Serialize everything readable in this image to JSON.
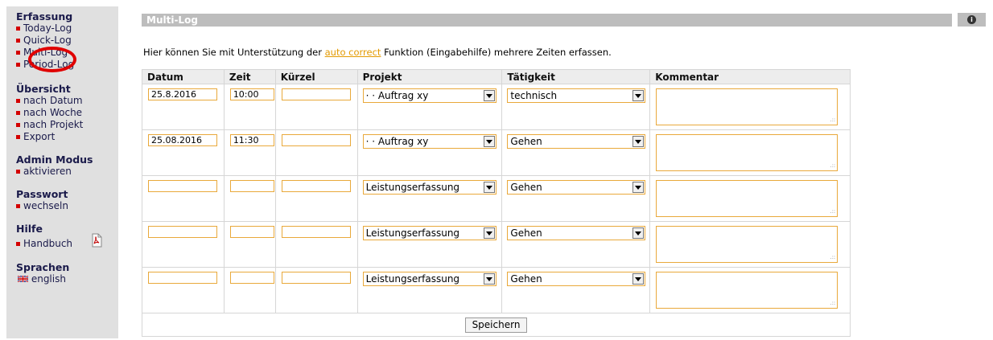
{
  "sidebar": {
    "sections": [
      {
        "title": "Erfassung",
        "items": [
          {
            "label": "Today-Log"
          },
          {
            "label": "Quick-Log"
          },
          {
            "label": "Multi-Log"
          },
          {
            "label": "Period-Log"
          }
        ]
      },
      {
        "title": "Übersicht",
        "items": [
          {
            "label": "nach Datum"
          },
          {
            "label": "nach Woche"
          },
          {
            "label": "nach Projekt"
          },
          {
            "label": "Export"
          }
        ]
      },
      {
        "title": "Admin Modus",
        "items": [
          {
            "label": "aktivieren"
          }
        ]
      },
      {
        "title": "Passwort",
        "items": [
          {
            "label": "wechseln"
          }
        ]
      },
      {
        "title": "Hilfe",
        "items": [
          {
            "label": "Handbuch"
          }
        ]
      },
      {
        "title": "Sprachen",
        "items": [
          {
            "label": "english"
          }
        ]
      }
    ]
  },
  "header": {
    "title": "Multi-Log",
    "info_icon": "info-icon"
  },
  "intro": {
    "before": "Hier können Sie mit Unterstützung der ",
    "link": "auto correct",
    "after": " Funktion (Eingabehilfe) mehrere Zeiten erfassen."
  },
  "table": {
    "columns": [
      "Datum",
      "Zeit",
      "Kürzel",
      "Projekt",
      "Tätigkeit",
      "Kommentar"
    ],
    "rows": [
      {
        "datum": "25.8.2016",
        "zeit": "10:00",
        "kuerzel": "",
        "projekt": "· · Auftrag xy",
        "taetigkeit": "technisch",
        "kommentar": ""
      },
      {
        "datum": "25.08.2016",
        "zeit": "11:30",
        "kuerzel": "",
        "projekt": "· · Auftrag xy",
        "taetigkeit": "Gehen",
        "kommentar": ""
      },
      {
        "datum": "",
        "zeit": "",
        "kuerzel": "",
        "projekt": "Leistungserfassung",
        "taetigkeit": "Gehen",
        "kommentar": ""
      },
      {
        "datum": "",
        "zeit": "",
        "kuerzel": "",
        "projekt": "Leistungserfassung",
        "taetigkeit": "Gehen",
        "kommentar": ""
      },
      {
        "datum": "",
        "zeit": "",
        "kuerzel": "",
        "projekt": "Leistungserfassung",
        "taetigkeit": "Gehen",
        "kommentar": ""
      }
    ],
    "save_label": "Speichern"
  },
  "colors": {
    "accent": "#e9a93b",
    "bullet": "#d40000",
    "highlight": "#e00000",
    "titlebar": "#bdbdbd",
    "sidebar": "#e0e0e0"
  }
}
